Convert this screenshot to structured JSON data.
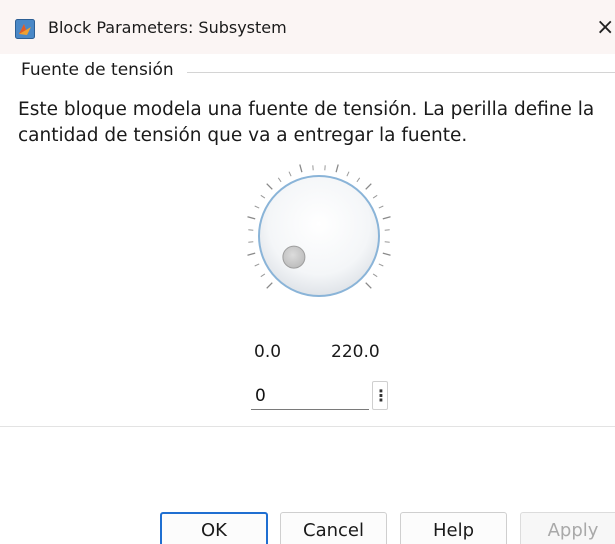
{
  "window": {
    "title": "Block Parameters: Subsystem",
    "icon": "simulink-block-icon",
    "close_label": "×"
  },
  "group": {
    "label": "Fuente de tensión"
  },
  "description": "Este bloque modela una fuente de tensión. La perilla define la cantidad de tensión que va a entregar la fuente.",
  "knob": {
    "min_label": "0.0",
    "max_label": "220.0",
    "value": "0",
    "menu_icon": "⋮",
    "level": 0
  },
  "buttons": {
    "ok": "OK",
    "cancel": "Cancel",
    "help": "Help",
    "apply": "Apply"
  },
  "colors": {
    "titlebar": "#fbf5f4",
    "focus_accent": "#1f6fd1",
    "knob_border": "#8ab4d8"
  }
}
